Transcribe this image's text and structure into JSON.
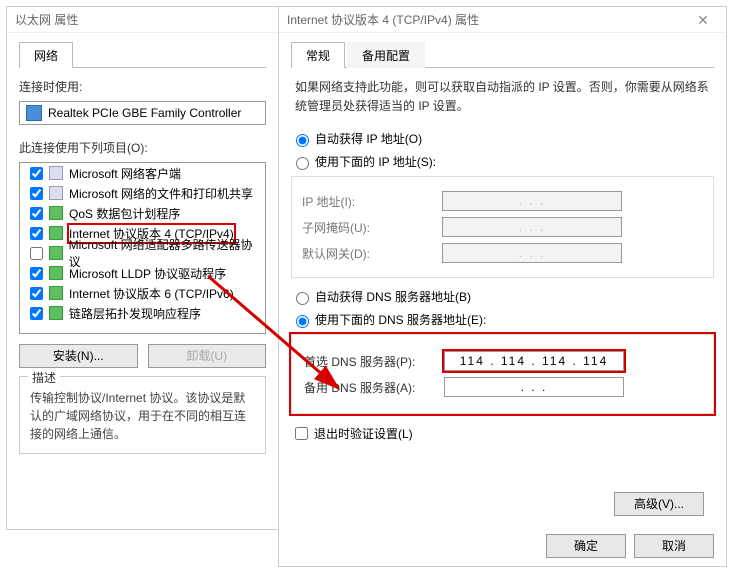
{
  "left": {
    "title": "以太网 属性",
    "tabs": {
      "network": "网络"
    },
    "connect_label": "连接时使用:",
    "adapter": "Realtek PCIe GBE Family Controller",
    "items_label": "此连接使用下列项目(O):",
    "items": [
      {
        "label": "Microsoft 网络客户端",
        "checked": true,
        "icon": "net"
      },
      {
        "label": "Microsoft 网络的文件和打印机共享",
        "checked": true,
        "icon": "net"
      },
      {
        "label": "QoS 数据包计划程序",
        "checked": true,
        "icon": "svc"
      },
      {
        "label": "Internet 协议版本 4 (TCP/IPv4)",
        "checked": true,
        "icon": "svc",
        "highlight": true
      },
      {
        "label": "Microsoft 网络适配器多路传送器协议",
        "checked": false,
        "icon": "svc"
      },
      {
        "label": "Microsoft LLDP 协议驱动程序",
        "checked": true,
        "icon": "svc"
      },
      {
        "label": "Internet 协议版本 6 (TCP/IPv6)",
        "checked": true,
        "icon": "svc"
      },
      {
        "label": "链路层拓扑发现响应程序",
        "checked": true,
        "icon": "svc"
      }
    ],
    "install_btn": "安装(N)...",
    "uninstall_btn": "卸载(U)",
    "desc_title": "描述",
    "desc_text": "传输控制协议/Internet 协议。该协议是默认的广域网络协议，用于在不同的相互连接的网络上通信。"
  },
  "right": {
    "title": "Internet 协议版本 4 (TCP/IPv4) 属性",
    "tabs": {
      "general": "常规",
      "alt": "备用配置"
    },
    "intro": "如果网络支持此功能，则可以获取自动指派的 IP 设置。否则，你需要从网络系统管理员处获得适当的 IP 设置。",
    "ip_auto": "自动获得 IP 地址(O)",
    "ip_manual": "使用下面的 IP 地址(S):",
    "ip_addr_label": "IP 地址(I):",
    "mask_label": "子网掩码(U):",
    "gw_label": "默认网关(D):",
    "dns_auto": "自动获得 DNS 服务器地址(B)",
    "dns_manual": "使用下面的 DNS 服务器地址(E):",
    "dns_pref_label": "首选 DNS 服务器(P):",
    "dns_pref_value": "114 . 114 . 114 . 114",
    "dns_alt_label": "备用 DNS 服务器(A):",
    "dns_alt_value": " .      .      . ",
    "validate": "退出时验证设置(L)",
    "advanced": "高级(V)...",
    "ok": "确定",
    "cancel": "取消",
    "ip_dots": " .      .      . "
  }
}
